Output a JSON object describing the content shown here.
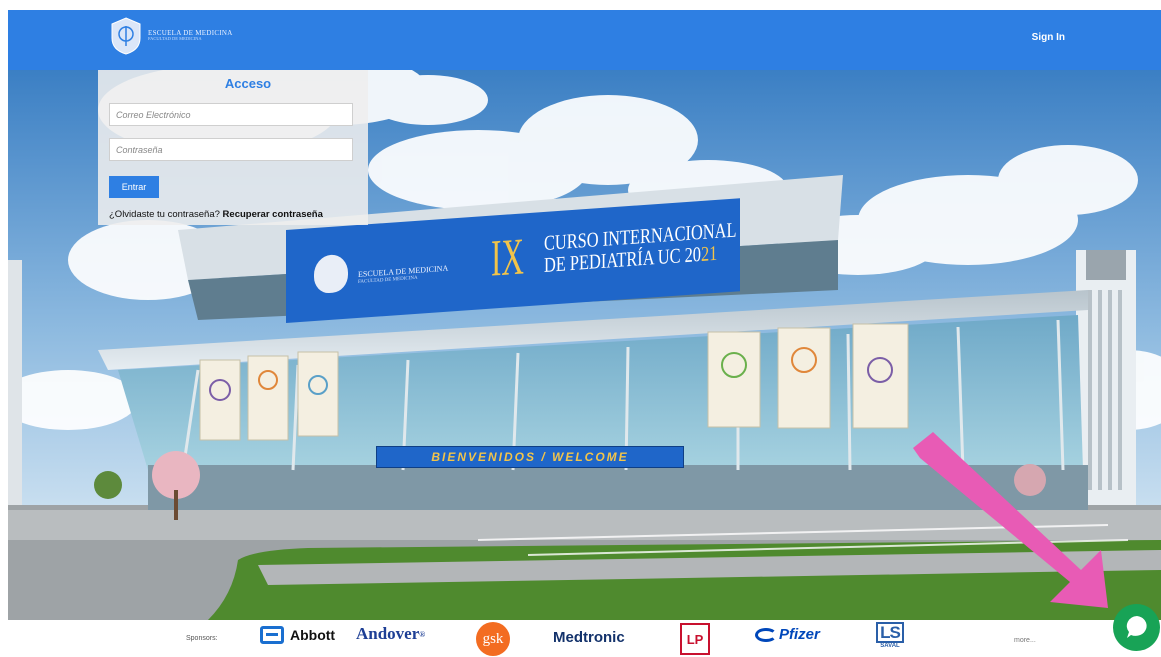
{
  "navbar": {
    "brand_line1": "ESCUELA DE MEDICINA",
    "brand_line2": "FACULTAD DE MEDICINA",
    "signin_label": "Sign In",
    "color": "#2e7fe3"
  },
  "login": {
    "title": "Acceso",
    "email_placeholder": "Correo Electrónico",
    "password_placeholder": "Contraseña",
    "submit_label": "Entrar",
    "forgot_text": "¿Olvidaste tu contraseña?",
    "recover_label": "Recuperar contraseña"
  },
  "scene": {
    "banner_school_line1": "ESCUELA DE MEDICINA",
    "banner_school_line2": "FACULTAD DE MEDICINA",
    "banner_numeral": "IX",
    "banner_line1": "CURSO INTERNACIONAL",
    "banner_line2_prefix": "DE PEDIATRÍA UC 20",
    "banner_line2_year": "21",
    "welcome_sign": "BIENVENIDOS / WELCOME",
    "arrow_color": "#e85bb5",
    "sky_color": "#4a8fd0"
  },
  "sponsors": {
    "label": "Sponsors:",
    "items": [
      "Abbott",
      "Andover",
      "gsk",
      "Medtronic",
      "LP",
      "Pfizer",
      "LS"
    ],
    "saval_label": "SAVAL",
    "more_label": "more..."
  },
  "chat": {
    "color": "#18a356",
    "icon": "chat-bubble-icon"
  }
}
